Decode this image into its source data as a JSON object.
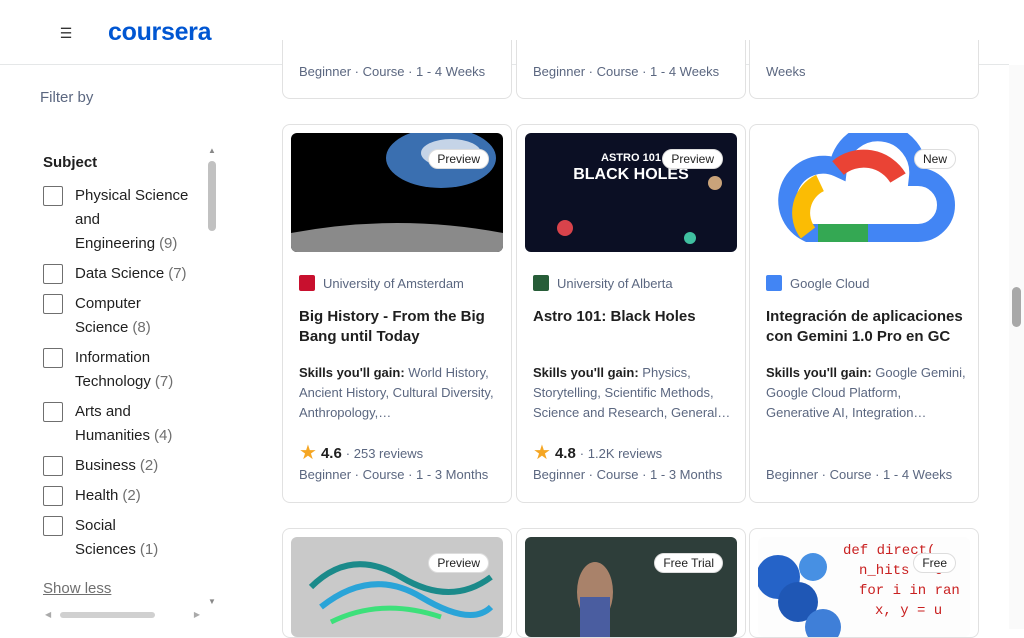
{
  "header": {
    "logo": "coursera",
    "menu_icon": "hamburger-menu-icon"
  },
  "sidebar": {
    "filter_by": "Filter by",
    "subject_title": "Subject",
    "items": [
      {
        "label": "Physical Science and Engineering",
        "count": "(9)"
      },
      {
        "label": "Data Science",
        "count": "(7)"
      },
      {
        "label": "Computer Science",
        "count": "(8)"
      },
      {
        "label": "Information Technology",
        "count": "(7)"
      },
      {
        "label": "Arts and Humanities",
        "count": "(4)"
      },
      {
        "label": "Business",
        "count": "(2)"
      },
      {
        "label": "Health",
        "count": "(2)"
      },
      {
        "label": "Social Sciences",
        "count": "(1)"
      }
    ],
    "show_less": "Show less"
  },
  "top_row": {
    "meta1": "Beginner · Course · 1 - 4 Weeks",
    "meta2": "Beginner · Course · 1 - 4 Weeks",
    "meta3": "Weeks"
  },
  "cards": [
    {
      "badge": "Preview",
      "thumb_text": "",
      "partner": "University of Amsterdam",
      "title": "Big History - From the Big Bang until Today",
      "skills_label": "Skills you'll gain:",
      "skills": "World History, Ancient History, Cultural Diversity, Anthropology,…",
      "rating": "4.6",
      "reviews": "253 reviews",
      "meta": "Beginner · Course · 1 - 3 Months",
      "partner_color": "#c8102e"
    },
    {
      "badge": "Preview",
      "thumb_text": "ASTRO 101 BLACK HOLES",
      "partner": "University of Alberta",
      "title": "Astro 101: Black Holes",
      "skills_label": "Skills you'll gain:",
      "skills": "Physics, Storytelling, Scientific Methods, Science and Research, General…",
      "rating": "4.8",
      "reviews": "1.2K reviews",
      "meta": "Beginner · Course · 1 - 3 Months",
      "partner_color": "#275d38"
    },
    {
      "badge": "New",
      "thumb_text": "",
      "partner": "Google Cloud",
      "title": "Integración de aplicaciones con Gemini 1.0 Pro en GC",
      "skills_label": "Skills you'll gain:",
      "skills": "Google Gemini, Google Cloud Platform, Generative AI, Integration…",
      "rating": "",
      "reviews": "",
      "meta": "Beginner · Course · 1 - 4 Weeks",
      "partner_color": "#4285f4"
    }
  ],
  "bottom_cards": [
    {
      "badge": "Preview"
    },
    {
      "badge": "Free Trial"
    },
    {
      "badge": "Free",
      "code_lines": [
        "def direct(",
        "n_hits = 0",
        "for i in ran",
        "x, y = u"
      ]
    }
  ],
  "colors": {
    "brand": "#0056d2",
    "star": "#f5a623"
  }
}
